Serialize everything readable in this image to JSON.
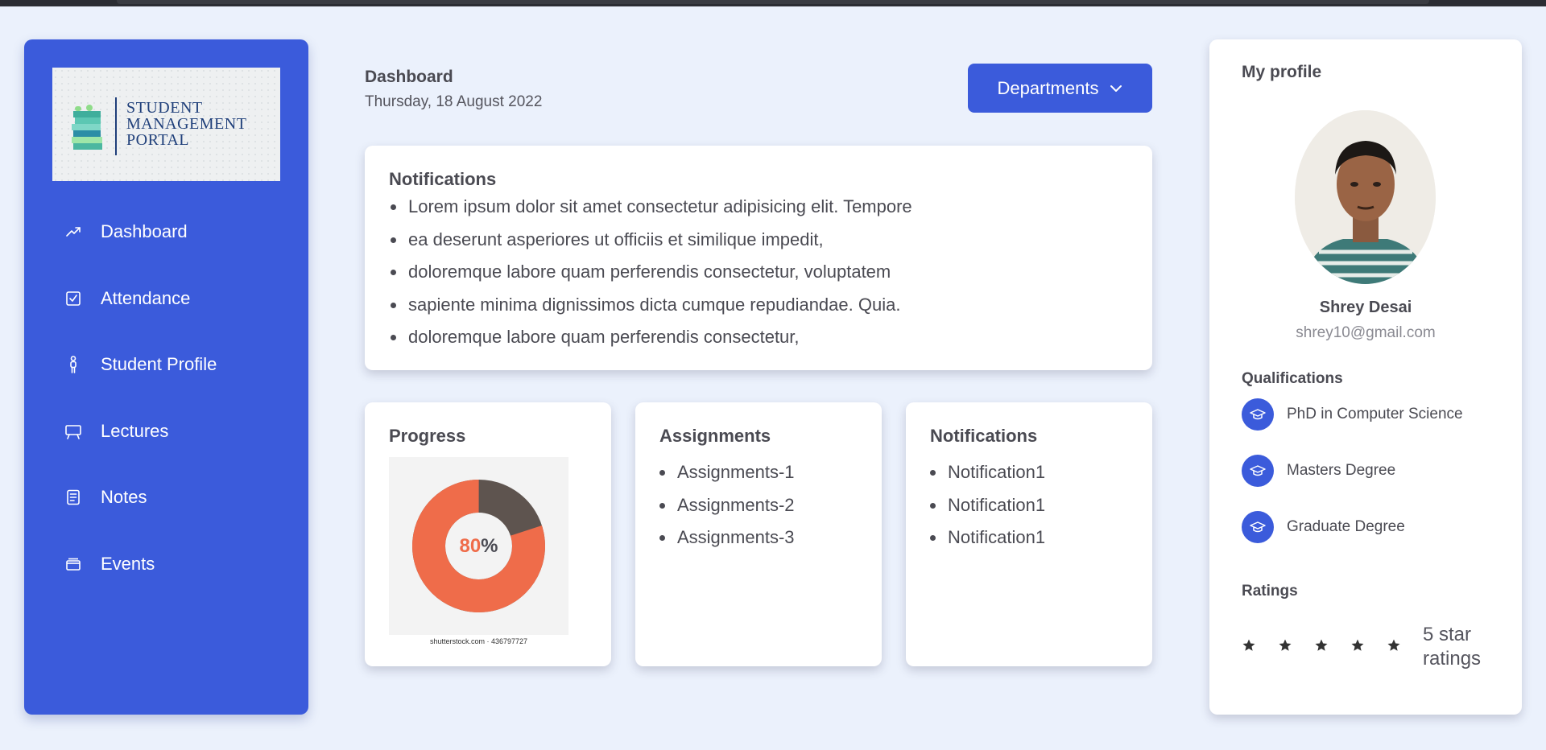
{
  "sidebar": {
    "logo": {
      "line1": "STUDENT",
      "line2": "MANAGEMENT",
      "line3": "PORTAL"
    },
    "items": [
      {
        "label": "Dashboard",
        "icon": "trending-up-icon"
      },
      {
        "label": "Attendance",
        "icon": "checkbox-icon"
      },
      {
        "label": "Student Profile",
        "icon": "person-icon"
      },
      {
        "label": "Lectures",
        "icon": "presentation-board-icon"
      },
      {
        "label": "Notes",
        "icon": "note-icon"
      },
      {
        "label": "Events",
        "icon": "folder-icon"
      }
    ]
  },
  "header": {
    "title": "Dashboard",
    "date": "Thursday, 18 August 2022",
    "departments_label": "Departments"
  },
  "notifications_main": {
    "title": "Notifications",
    "items": [
      "Lorem ipsum dolor sit amet consectetur adipisicing elit. Tempore",
      "ea deserunt asperiores ut officiis et similique impedit,",
      "doloremque labore quam perferendis consectetur, voluptatem",
      "sapiente minima dignissimos dicta cumque repudiandae. Quia.",
      "doloremque labore quam perferendis consectetur,"
    ]
  },
  "progress": {
    "title": "Progress",
    "value": 80,
    "number": "80",
    "symbol": "%",
    "caption": "shutterstock.com · 436797727"
  },
  "assignments": {
    "title": "Assignments",
    "items": [
      "Assignments-1",
      "Assignments-2",
      "Assignments-3"
    ]
  },
  "notifications_small": {
    "title": "Notifications",
    "items": [
      "Notification1",
      "Notification1",
      "Notification1"
    ]
  },
  "profile": {
    "title": "My profile",
    "name": "Shrey Desai",
    "email": "shrey10@gmail.com",
    "qualifications_label": "Qualifications",
    "qualifications": [
      "PhD in Computer Science",
      "Masters Degree",
      "Graduate Degree"
    ],
    "ratings_label": "Ratings",
    "rating": 5,
    "rating_text": "5 star ratings"
  },
  "colors": {
    "primary": "#3b5bdb",
    "background": "#ebf1fc",
    "donut_accent": "#ef6c4a",
    "donut_dark": "#5e544f"
  }
}
